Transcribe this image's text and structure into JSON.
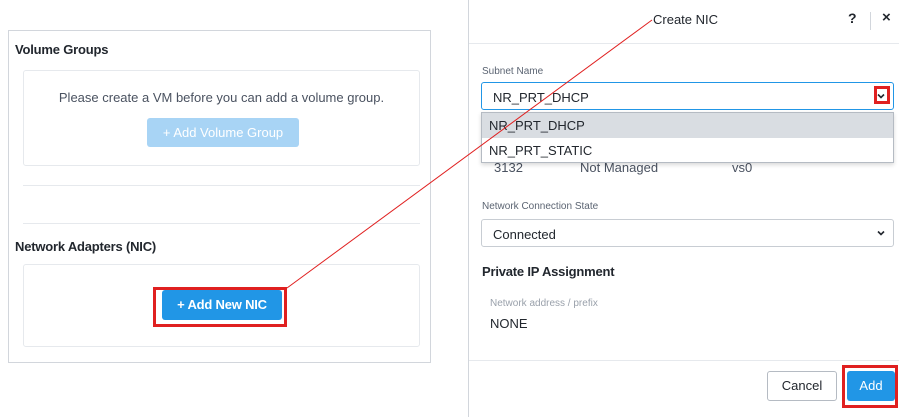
{
  "left_panel": {
    "volume_groups": {
      "title": "Volume Groups",
      "message": "Please create a VM before you can add a volume group.",
      "add_button": "+ Add Volume Group"
    },
    "network_adapters": {
      "title": "Network Adapters (NIC)",
      "add_button": "+ Add New NIC"
    }
  },
  "dialog": {
    "title": "Create NIC",
    "help": "?",
    "close": "×",
    "subnet": {
      "label": "Subnet Name",
      "value": "NR_PRT_DHCP",
      "options": [
        "NR_PRT_DHCP",
        "NR_PRT_STATIC"
      ]
    },
    "obscured_row": [
      "3132",
      "Not Managed",
      "vs0"
    ],
    "network_connection_state": {
      "label": "Network Connection State",
      "value": "Connected"
    },
    "private_ip": {
      "title": "Private IP Assignment",
      "address_label": "Network address / prefix",
      "address_value": "NONE"
    },
    "footer": {
      "cancel": "Cancel",
      "add": "Add"
    }
  },
  "colors": {
    "primary": "#2196e6",
    "primary_disabled": "#a8d4f5",
    "highlight": "#e02020"
  }
}
